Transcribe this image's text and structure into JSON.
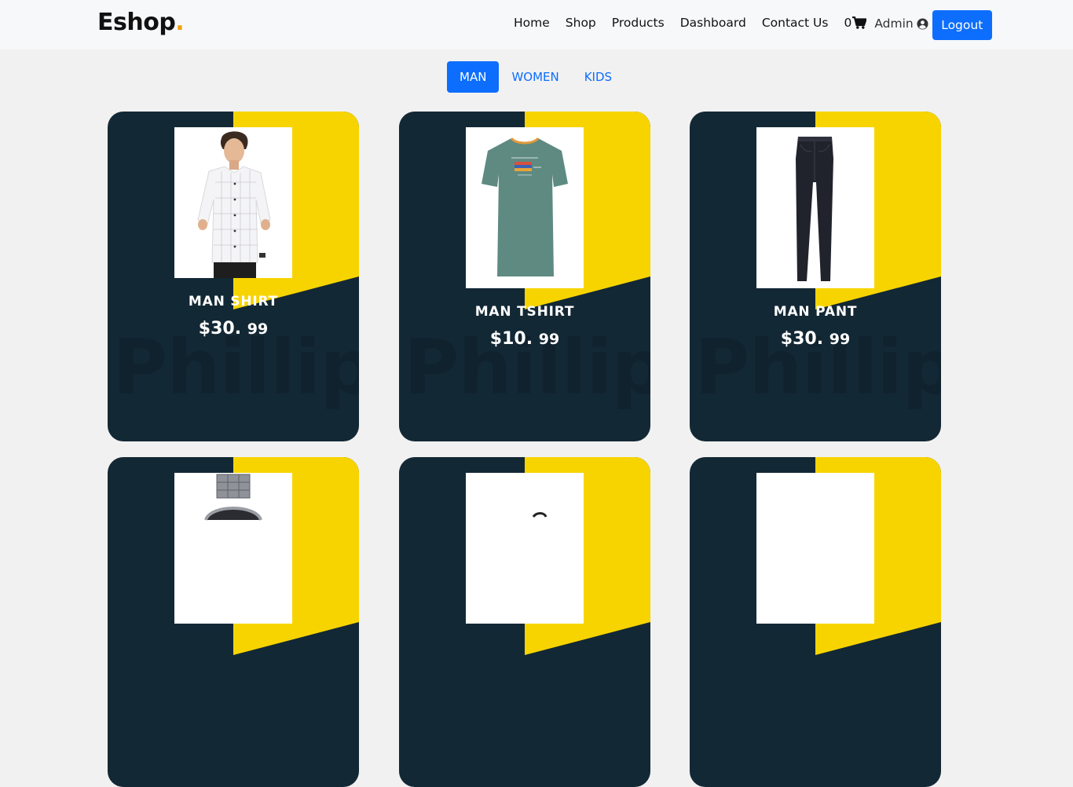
{
  "navbar": {
    "brand_text": "Eshop",
    "brand_dot": ".",
    "links": [
      "Home",
      "Shop",
      "Products",
      "Dashboard",
      "Contact Us"
    ],
    "cart_count": "0",
    "user_name": "Admin",
    "logout_label": "Logout"
  },
  "tabs": [
    {
      "label": "MAN",
      "active": true
    },
    {
      "label": "WOMEN",
      "active": false
    },
    {
      "label": "KIDS",
      "active": false
    }
  ],
  "products": [
    {
      "name": "MAN SHIRT",
      "price_main": "$30.",
      "price_cents": "99",
      "watermark": "Phillip"
    },
    {
      "name": "MAN TSHIRT",
      "price_main": "$10.",
      "price_cents": "99",
      "watermark": "Phillip"
    },
    {
      "name": "MAN PANT",
      "price_main": "$30.",
      "price_cents": "99",
      "watermark": "Phillip"
    },
    {
      "name": "",
      "price_main": "",
      "price_cents": "",
      "watermark": ""
    },
    {
      "name": "",
      "price_main": "",
      "price_cents": "",
      "watermark": ""
    },
    {
      "name": "",
      "price_main": "",
      "price_cents": "",
      "watermark": ""
    }
  ],
  "colors": {
    "card_dark": "#132835",
    "card_yellow": "#f7d400",
    "primary": "#0d6efd",
    "brand_dot": "#f29f05"
  }
}
